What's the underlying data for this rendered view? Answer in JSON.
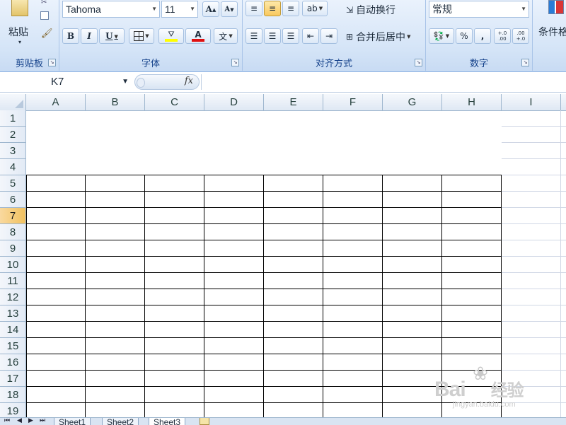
{
  "ribbon": {
    "clipboard": {
      "paste_label": "粘贴",
      "group_label": "剪贴板",
      "icons": [
        "paste-icon",
        "cut-icon",
        "copy-icon",
        "format-painter-icon"
      ]
    },
    "font": {
      "font_name": "Tahoma",
      "font_size": "11",
      "grow_label": "A",
      "shrink_label": "A",
      "bold": "B",
      "italic": "I",
      "underline": "U",
      "font_color_label": "A",
      "phonetic_label": "文",
      "group_label": "字体",
      "fill_color": "#ffff00",
      "text_color": "#e01010"
    },
    "alignment": {
      "wrap_text": "自动换行",
      "merge_center": "合并后居中",
      "group_label": "对齐方式"
    },
    "number": {
      "format": "常规",
      "percent": "%",
      "comma": ",",
      "increase_decimal": "+.0 .00",
      "decrease_decimal": ".00 +.0",
      "group_label": "数字"
    },
    "styles": {
      "conditional_format": "条件格"
    }
  },
  "formula_bar": {
    "name_box": "K7",
    "fx": "fx",
    "formula": ""
  },
  "grid": {
    "columns": [
      "A",
      "B",
      "C",
      "D",
      "E",
      "F",
      "G",
      "H",
      "I"
    ],
    "rows": [
      "1",
      "2",
      "3",
      "4",
      "5",
      "6",
      "7",
      "8",
      "9",
      "10",
      "11",
      "12",
      "13",
      "14",
      "15",
      "16",
      "17",
      "18",
      "19"
    ],
    "selected_row": "7"
  },
  "sheets": {
    "tabs": [
      "Sheet1",
      "Sheet2",
      "Sheet3"
    ],
    "active": "Sheet3"
  },
  "watermark": {
    "brand": "Bai",
    "brand2": "经验",
    "url": "jingyan.baidu.com"
  },
  "colors": {
    "ribbon": "#d4e4f7",
    "selected_header": "#f1c15f",
    "gridline": "#d0d7e5"
  }
}
